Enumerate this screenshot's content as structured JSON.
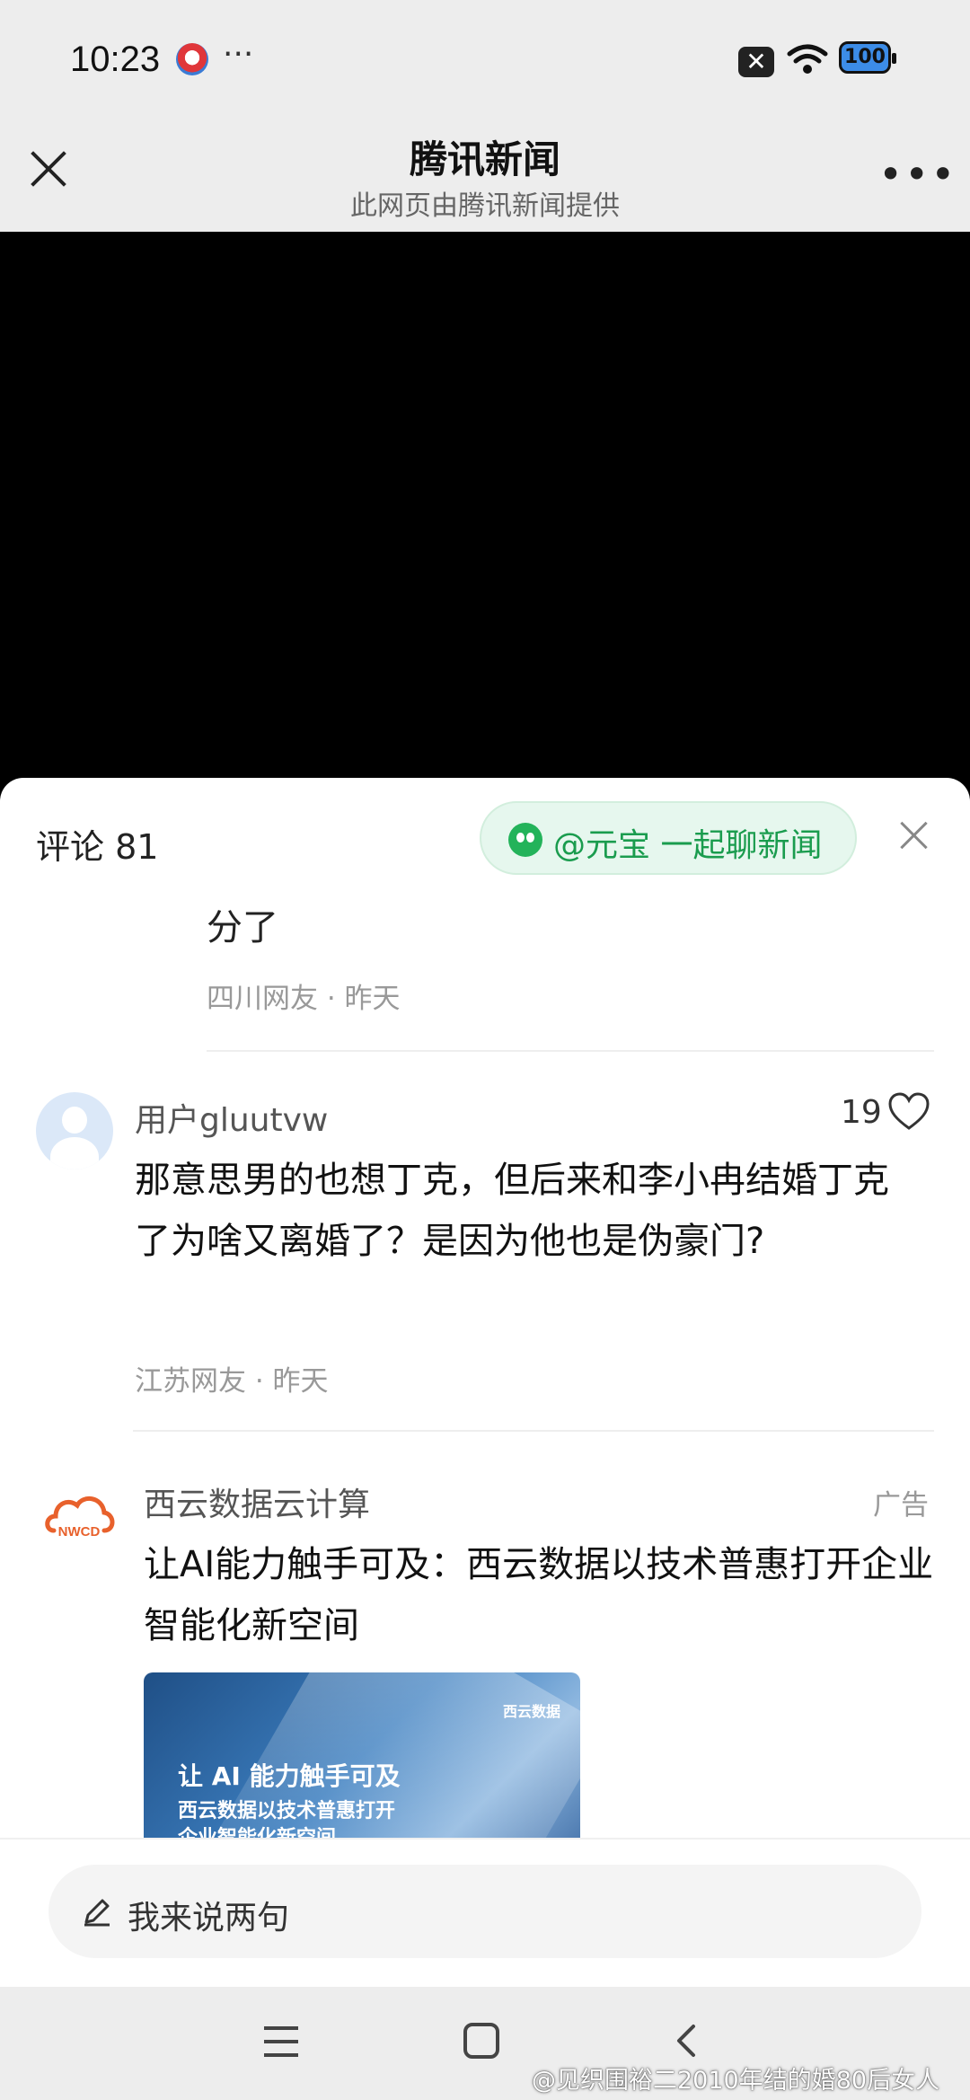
{
  "status_bar": {
    "time": "10:23",
    "more_dots": "···",
    "battery": "100"
  },
  "title_bar": {
    "title": "腾讯新闻",
    "subtitle": "此网页由腾讯新闻提供"
  },
  "comments_sheet": {
    "title": "评论 81",
    "yuanbao_button": "@元宝 一起聊新闻",
    "reply": {
      "text": "分了",
      "meta": "四川网友 · 昨天"
    },
    "comment": {
      "user": "用户gluutvw",
      "likes": "19",
      "body": "那意思男的也想丁克，但后来和李小冉结婚丁克了为啥又离婚了？是因为他也是伪豪门?",
      "meta": "江苏网友 · 昨天"
    },
    "ad": {
      "advertiser": "西云数据云计算",
      "label": "广告",
      "headline": "让AI能力触手可及：西云数据以技术普惠打开企业智能化新空间",
      "logo_text": "NWCD",
      "image": {
        "brand": "西云数据",
        "line1": "让 AI 能力触手可及",
        "line2": "西云数据以技术普惠打开",
        "line3": "企业智能化新空间"
      }
    }
  },
  "input_bar": {
    "placeholder": "我来说两句"
  },
  "watermark": "@见织围裕二2010年结的婚80后女人",
  "colors": {
    "accent_green": "#1a9c4e",
    "ad_orange": "#e8612c"
  }
}
